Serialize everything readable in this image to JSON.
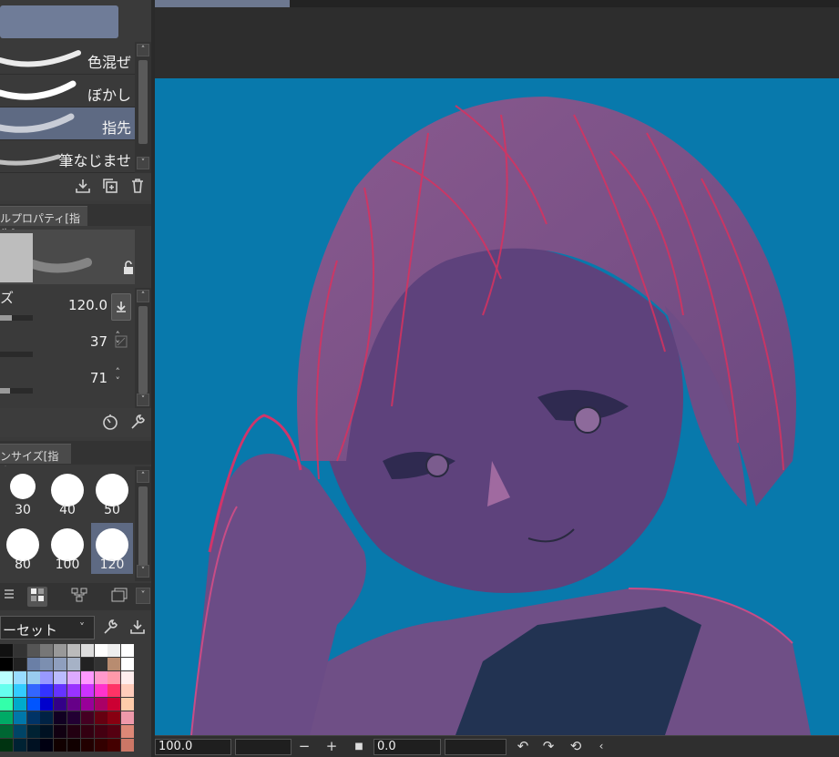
{
  "brush_list": {
    "items": [
      {
        "label": "色混ぜ",
        "selected": false
      },
      {
        "label": "ぼかし",
        "selected": false
      },
      {
        "label": "指先",
        "selected": true
      },
      {
        "label": "筆なじませ",
        "selected": false
      }
    ]
  },
  "tool_property": {
    "tab_label": "ルプロパティ[指先]",
    "rows": [
      {
        "label": "ズ",
        "value": "120.0",
        "fill_fraction": 0.8
      },
      {
        "label": "",
        "value": "37",
        "fill_fraction": 0.0
      },
      {
        "label": "",
        "value": "71",
        "fill_fraction": 0.5
      }
    ]
  },
  "brush_size": {
    "tab_label": "ンサイズ[指先]",
    "cells": [
      {
        "label": "30",
        "selected": false
      },
      {
        "label": "40",
        "selected": false
      },
      {
        "label": "50",
        "selected": false
      },
      {
        "label": "80",
        "selected": false
      },
      {
        "label": "100",
        "selected": false
      },
      {
        "label": "120",
        "selected": true
      }
    ]
  },
  "color_set": {
    "preset_label": "ーセット"
  },
  "status_bar": {
    "zoom": "100.0",
    "rotation": "0.0"
  },
  "colors": {
    "canvas_bg": "#0879ac",
    "selection": "#5e6a83"
  }
}
